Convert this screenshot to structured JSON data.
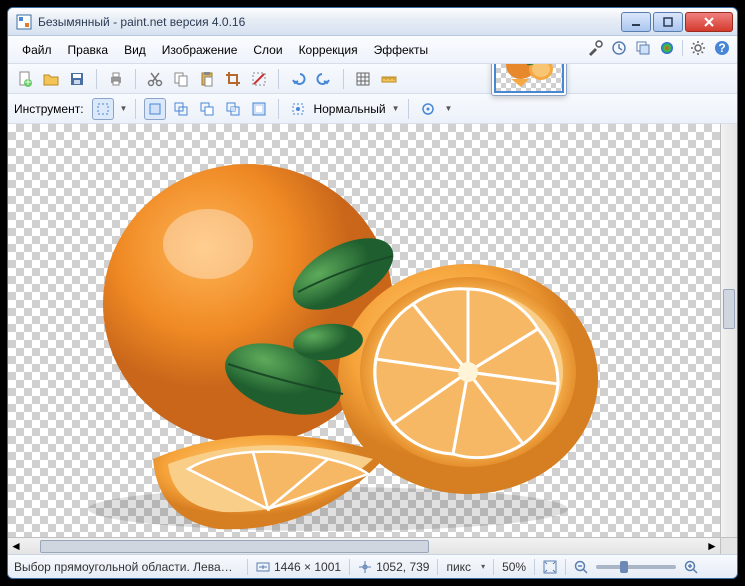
{
  "title": "Безымянный - paint.net версия 4.0.16",
  "menu": {
    "file": "Файл",
    "edit": "Правка",
    "view": "Вид",
    "image": "Изображение",
    "layers": "Слои",
    "adjust": "Коррекция",
    "effects": "Эффекты"
  },
  "toolrow": {
    "label": "Инструмент:",
    "blend_mode": "Нормальный"
  },
  "status": {
    "hint": "Выбор прямоугольной области. Левая кнопка - выделе...",
    "dims": "1446 × 1001",
    "cursor": "1052, 739",
    "unit": "пикс",
    "zoom": "50%"
  },
  "icons": {
    "new": "new-file-icon",
    "open": "open-folder-icon",
    "save": "save-icon",
    "print": "print-icon",
    "cut": "cut-icon",
    "copy": "copy-icon",
    "paste": "paste-icon",
    "crop": "crop-icon",
    "deselect": "deselect-icon",
    "undo": "undo-icon",
    "redo": "redo-icon",
    "grid": "grid-icon",
    "ruler": "ruler-icon"
  },
  "util": {
    "tools": "tools-icon",
    "history": "history-icon",
    "layers": "layers-icon",
    "colors": "colors-icon",
    "settings": "settings-icon",
    "help": "help-icon"
  },
  "colors": {
    "accent": "#4787d6",
    "titlebar": "#e6ecf5",
    "close": "#d43b2d"
  }
}
